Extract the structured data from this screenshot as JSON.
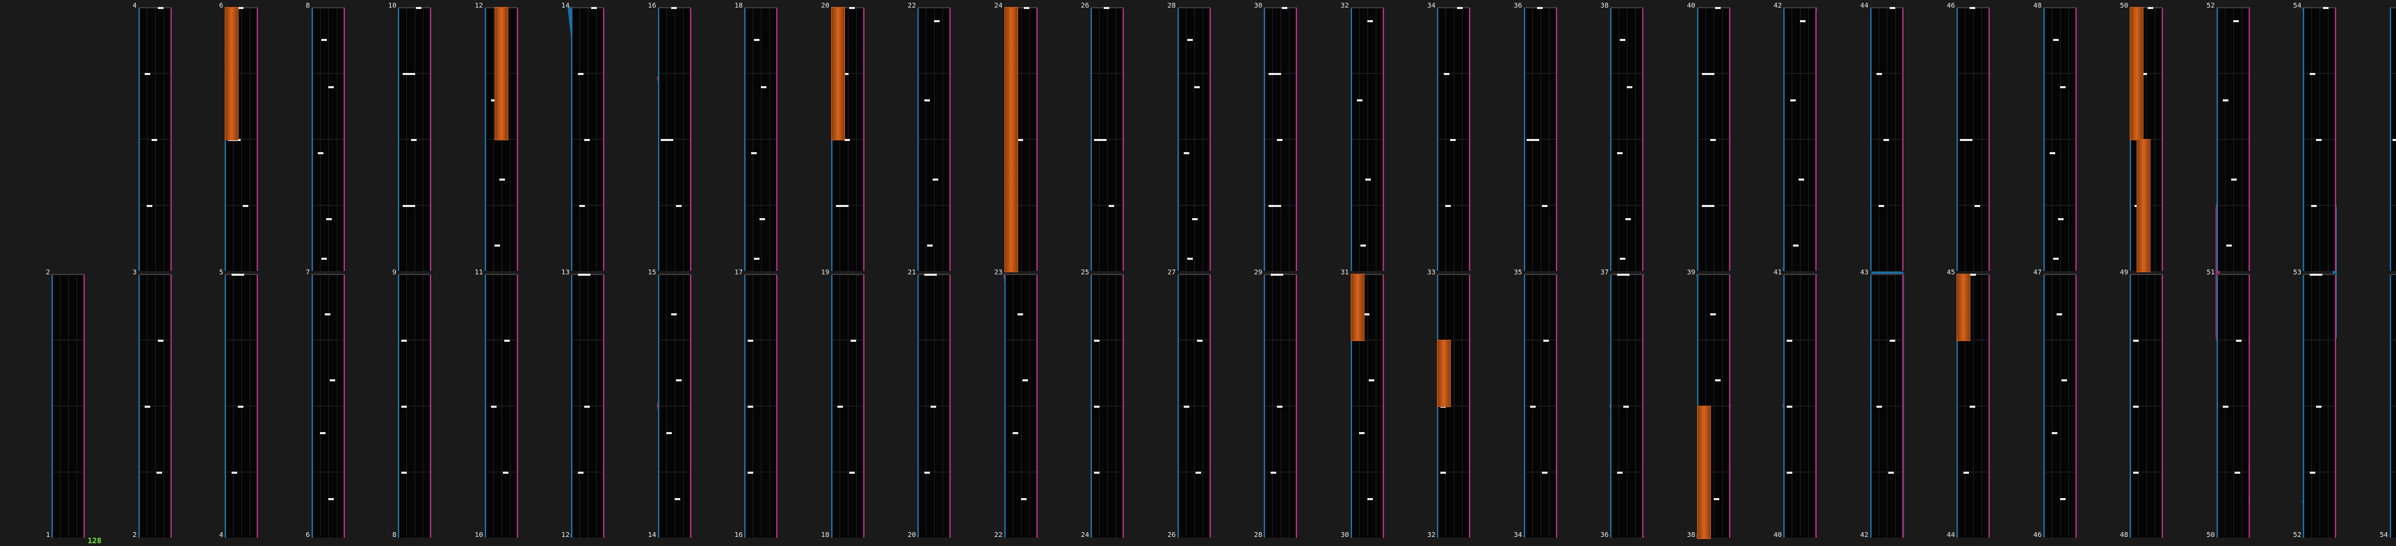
{
  "chart_editor": {
    "combo_counter": "128",
    "colors": {
      "background": "#1a1a1a",
      "lane": "#050505",
      "lane_left_edge": "#1f6fa3",
      "lane_right_edge": "#b02e7e",
      "note": "#e8e8e8",
      "hold_note": "#d8641e",
      "slide_blue": "#1a6fa3",
      "slide_pink": "#a3306f",
      "counter": "#79e83a"
    },
    "measure_labels": [
      "1",
      "2",
      "3",
      "4",
      "5",
      "6",
      "7",
      "8",
      "9",
      "10",
      "11",
      "12",
      "13",
      "14",
      "15",
      "16",
      "17",
      "18",
      "19",
      "20",
      "21",
      "22",
      "23",
      "24",
      "25",
      "26",
      "27",
      "28",
      "29",
      "30",
      "31",
      "32",
      "33",
      "34",
      "35",
      "36",
      "37",
      "38",
      "39",
      "40",
      "41",
      "42",
      "43",
      "44",
      "45",
      "46",
      "47",
      "48",
      "49",
      "50",
      "51",
      "52",
      "53",
      "54"
    ]
  }
}
